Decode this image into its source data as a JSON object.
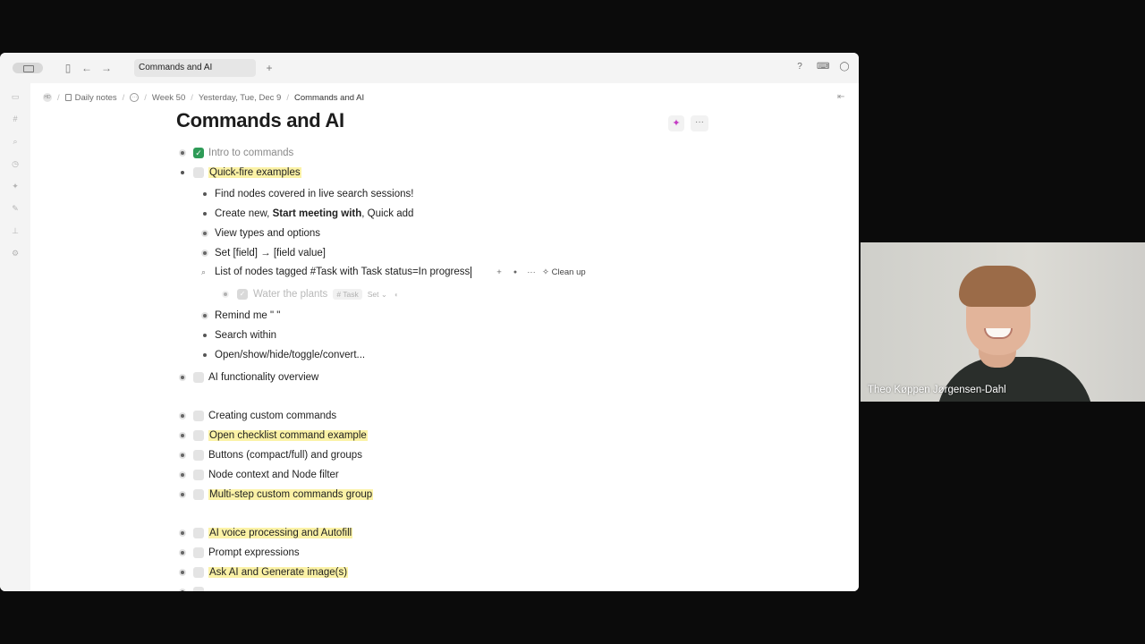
{
  "titlebar": {
    "tab_label": "Commands and AI",
    "new_tab": "+",
    "back": "←",
    "forward": "→"
  },
  "breadcrumb": {
    "workspace": "HD",
    "daily_notes": "Daily notes",
    "week": "Week 50",
    "day": "Yesterday, Tue, Dec 9",
    "current": "Commands and AI"
  },
  "page": {
    "title": "Commands and AI",
    "ai_icon": "sparkle-icon",
    "more": "···"
  },
  "outline": {
    "intro": "Intro to commands",
    "quickfire": "Quick-fire examples",
    "children": {
      "find_nodes": "Find nodes covered in live search sessions!",
      "create_prefix": "Create new, ",
      "create_bold": "Start meeting with",
      "create_suffix": ", Quick add",
      "view_types": "View types and options",
      "set_field": "Set [field] → [field value]",
      "search_query": "List of nodes tagged #Task with Task status=In progress",
      "water_plants": "Water the plants",
      "task_tag": "# Task",
      "set_chip": "Set ⌄",
      "remind": "Remind me \" \"",
      "search_within": "Search within",
      "open_show": "Open/show/hide/toggle/convert..."
    },
    "tools": {
      "plus": "+",
      "dot": "●",
      "more": "···",
      "cleanup": "Clean up"
    },
    "ai_overview": "AI functionality overview",
    "creating_custom": "Creating custom commands",
    "open_checklist": "Open checklist command example",
    "buttons": "Buttons (compact/full) and groups",
    "node_context": "Node context and Node filter",
    "multistep": "Multi-step custom commands group",
    "voice": "AI voice processing and Autofill",
    "prompt_expr": "Prompt expressions",
    "ask_ai": "Ask AI and Generate image(s)"
  },
  "webcam": {
    "participant_name": "Theo Køppen Jørgensen-Dahl"
  },
  "colors": {
    "highlight": "#fbf2a6",
    "checked_green": "#2e9b57",
    "ai_accent": "#c43cc4"
  }
}
